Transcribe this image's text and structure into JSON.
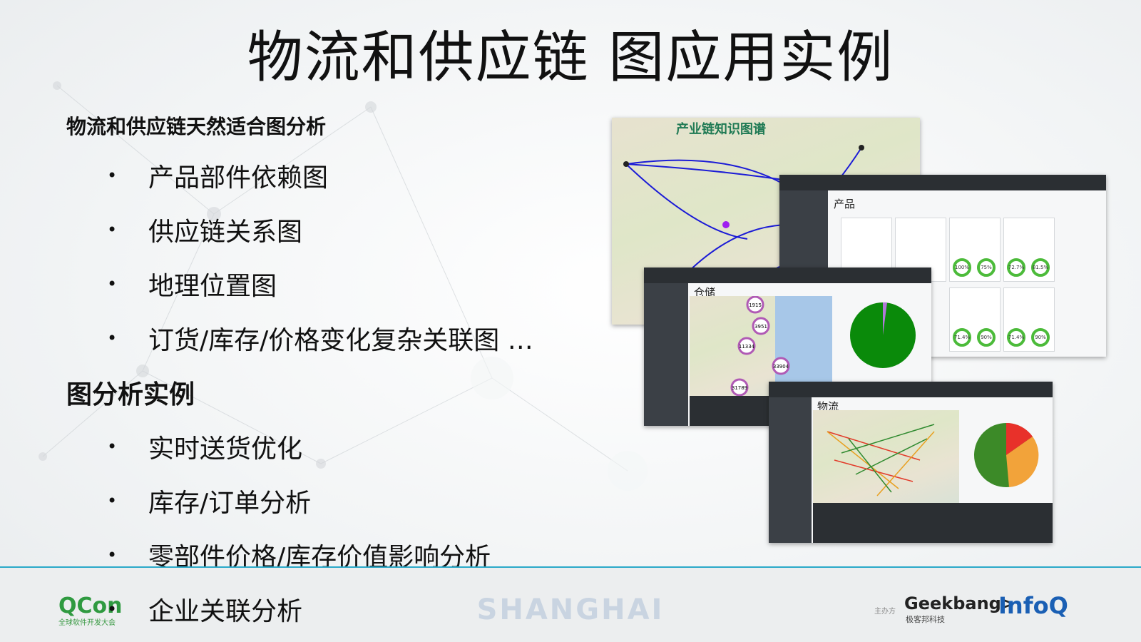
{
  "slide": {
    "title": "物流和供应链 图应用实例"
  },
  "section1": {
    "heading": "物流和供应链天然适合图分析",
    "bullets": [
      "产品部件依赖图",
      "供应链关系图",
      "地理位置图",
      "订货/库存/价格变化复杂关联图 …"
    ]
  },
  "section2": {
    "heading": "图分析实例",
    "bullets": [
      "实时送货优化",
      "库存/订单分析",
      "零部件价格/库存价值影响分析",
      "企业关联分析"
    ]
  },
  "collage": {
    "map_title": "产业链知识图谱",
    "product_label": "产品",
    "warehouse_label": "仓储",
    "logistics_label": "物流",
    "product_rings": [
      "100%",
      "75%",
      "72.7%",
      "81.5%",
      "71.4%",
      "90%",
      "71.4%",
      "90%"
    ],
    "warehouse_markers": [
      "1915",
      "3951",
      "11334",
      "33904",
      "31789"
    ]
  },
  "footer": {
    "brand": "QCon",
    "brand_sub": "全球软件开发大会",
    "city": "SHANGHAI",
    "host_label": "主办方",
    "geekbang": "Geekbang>.",
    "geekbang_sub": "极客邦科技",
    "infoq": "InfoQ"
  },
  "colors": {
    "accent_line": "#2aa9c9",
    "qcon_green": "#2f9a40",
    "infoq_blue": "#1a5fb4",
    "map_edge_blue": "#1b1bd6"
  }
}
